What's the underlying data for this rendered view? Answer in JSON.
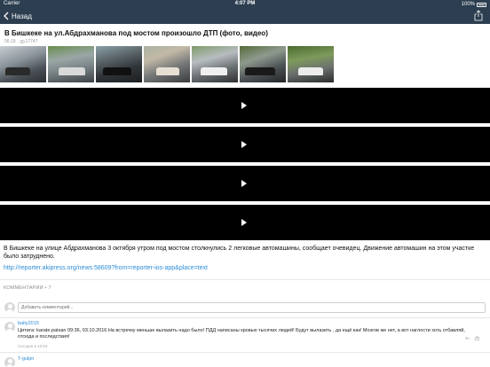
{
  "status_bar": {
    "carrier": "Carrier",
    "time": "4:07 PM",
    "battery": "100%"
  },
  "nav": {
    "back_label": "Назад"
  },
  "article": {
    "title": "В Бишкеке на ул.Абдрахманова под мостом произошло ДТП (фото, видео)",
    "time": "06:19",
    "views": "17747",
    "photo_count": 7,
    "video_count": 4,
    "body": "В Бишкеке на улице Абдрахманова 3 октября утром под мостом столкнулись 2 легковые автомашины, сообщает очевидец. Движение автомашин на этом участке было затруднено.",
    "link": "http://reporter.akipress.org/news:58609?from=reporter-ios-app&place=text"
  },
  "comments": {
    "header": "КОММЕНТАРИИ",
    "count": "7",
    "input_placeholder": "Добавить комментарий...",
    "items": [
      {
        "author": "balty2015",
        "text": "Цитата: karate.patsan 09:36, 03.10.2016 На встречку меньше вылазить надо было! ПДД написаны кровью тысячих людей!  Будут вылазить , да ещё как! Мозгов же нет, а вот наглости хоть отбавляй, отсюда и последствия!",
        "date": "Сегодня в 10:53"
      },
      {
        "author": "T-gulpn",
        "text": "",
        "date": ""
      }
    ]
  },
  "colors": {
    "nav_bg": "#2c3e50",
    "link": "#2d8cd6",
    "video_bg": "#000000"
  }
}
